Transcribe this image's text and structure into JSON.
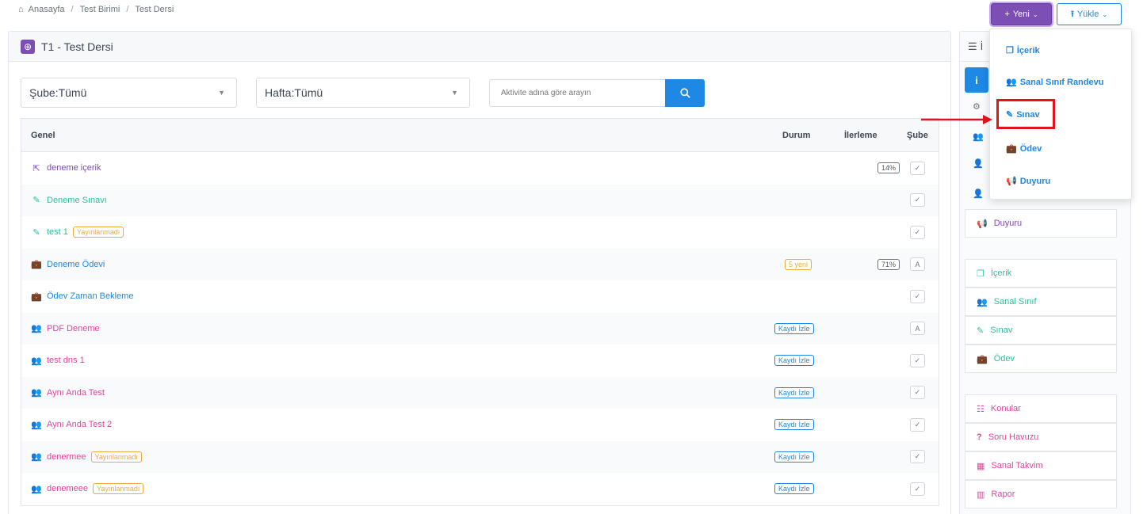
{
  "breadcrumb": {
    "home": "Anasayfa",
    "unit": "Test Birimi",
    "course": "Test Dersi",
    "separator": "/"
  },
  "toolbar": {
    "new_label": "Yeni",
    "upload_label": "Yükle"
  },
  "card": {
    "title": "T1 - Test Dersi"
  },
  "filters": {
    "branch": "Şube:Tümü",
    "week": "Hafta:Tümü",
    "search_placeholder": "Aktivite adına göre arayın"
  },
  "table": {
    "headers": {
      "genel": "Genel",
      "durum": "Durum",
      "ilerleme": "İlerleme",
      "sube": "Şube"
    },
    "rows": [
      {
        "name": "deneme içerik",
        "icon": "external-link-icon",
        "color": "#7b4fb3",
        "badge": "",
        "durum": "",
        "progress": "14%",
        "sube": "✓"
      },
      {
        "name": "Deneme Sınavı",
        "icon": "edit-icon",
        "color": "#2bbf9d",
        "badge": "",
        "durum": "",
        "progress": "",
        "sube": "✓"
      },
      {
        "name": "test 1",
        "icon": "edit-icon",
        "color": "#2bbf9d",
        "badge": "Yayınlanmadı",
        "durum": "",
        "progress": "",
        "sube": "✓"
      },
      {
        "name": "Deneme Ödevi",
        "icon": "briefcase-icon",
        "color": "#1e88e5",
        "badge": "",
        "durum": "5 yeni",
        "progress": "71%",
        "sube": "A"
      },
      {
        "name": "Ödev Zaman Bekleme",
        "icon": "briefcase-icon",
        "color": "#1e88e5",
        "badge": "",
        "durum": "",
        "progress": "",
        "sube": "✓"
      },
      {
        "name": "PDF Deneme",
        "icon": "users-icon",
        "color": "#e2459c",
        "badge": "",
        "durum": "Kaydı İzle",
        "progress": "",
        "sube": "A"
      },
      {
        "name": "test dns 1",
        "icon": "users-icon",
        "color": "#e2459c",
        "badge": "",
        "durum": "Kaydı İzle",
        "progress": "",
        "sube": "✓"
      },
      {
        "name": "Aynı Anda Test",
        "icon": "users-icon",
        "color": "#e2459c",
        "badge": "",
        "durum": "Kaydı İzle",
        "progress": "",
        "sube": "✓"
      },
      {
        "name": "Aynı Anda Test 2",
        "icon": "users-icon",
        "color": "#e2459c",
        "badge": "",
        "durum": "Kaydı İzle",
        "progress": "",
        "sube": "✓"
      },
      {
        "name": "denermee",
        "icon": "users-icon",
        "color": "#e2459c",
        "badge": "Yayınlanmadı",
        "durum": "Kaydı İzle",
        "progress": "",
        "sube": "✓"
      },
      {
        "name": "denemeee",
        "icon": "users-icon",
        "color": "#e2459c",
        "badge": "Yayınlanmadı",
        "durum": "Kaydı İzle",
        "progress": "",
        "sube": "✓"
      }
    ]
  },
  "sidebar": {
    "header_initial": "İ",
    "info_label": "i",
    "duyuru": "Duyuru",
    "group2": {
      "icerik": "İçerik",
      "sanal_sinif": "Sanal Sınıf",
      "sinav": "Sınav",
      "odev": "Ödev"
    },
    "group3": {
      "konular": "Konular",
      "soru_havuzu": "Soru Havuzu",
      "sanal_takvim": "Sanal Takvim",
      "rapor": "Rapor"
    }
  },
  "dropdown": {
    "items": {
      "icerik": "İçerik",
      "sanal_sinif_randevu": "Sanal Sınıf Randevu",
      "sinav": "Sınav",
      "odev": "Ödev",
      "duyuru": "Duyuru"
    }
  },
  "colors": {
    "accent_purple": "#7b4fb3",
    "accent_blue": "#1e88e5",
    "accent_green": "#2bbf9d",
    "accent_pink": "#e2459c",
    "highlight_red": "#e3121a"
  }
}
